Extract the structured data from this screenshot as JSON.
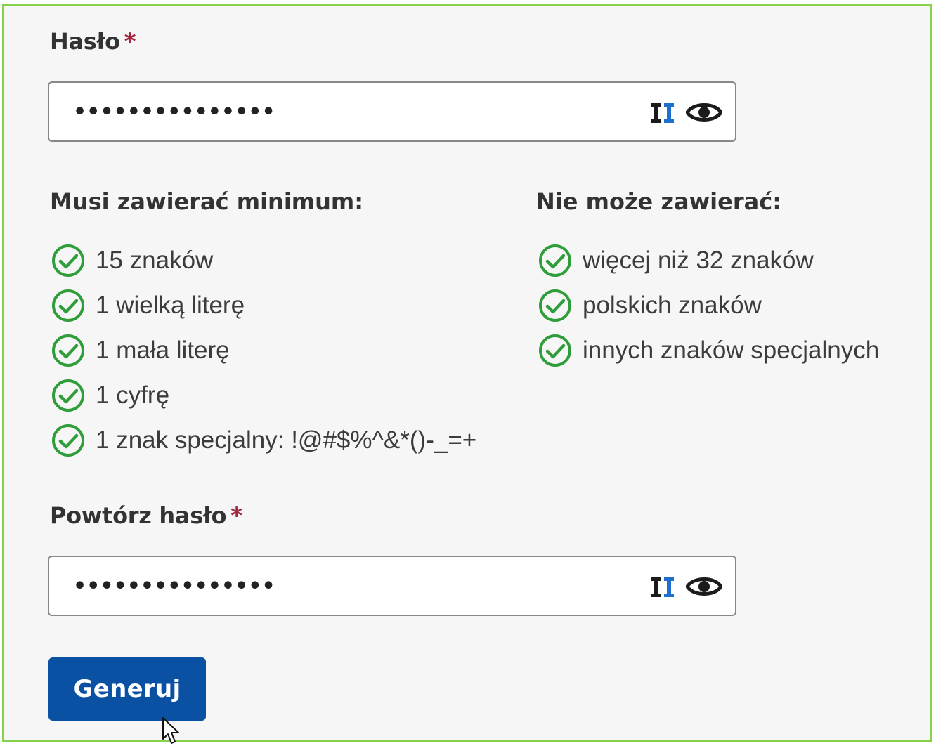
{
  "password_field": {
    "label": "Hasło",
    "required_mark": "*",
    "value": "•••••••••••••••",
    "generate_icon": "generator-icon",
    "toggle_icon": "eye-icon"
  },
  "rules": {
    "must_title": "Musi zawierać minimum:",
    "must_items": [
      "15 znaków",
      "1 wielką literę",
      "1 mała literę",
      "1 cyfrę",
      "1 znak specjalny: !@#$%^&*()-_=+"
    ],
    "cannot_title": "Nie może zawierać:",
    "cannot_items": [
      "więcej niż 32 znaków",
      "polskich znaków",
      "innych znaków specjalnych"
    ],
    "status_icon": "check-circle-icon"
  },
  "repeat_field": {
    "label": "Powtórz hasło",
    "required_mark": "*",
    "value": "•••••••••••••••",
    "generate_icon": "generator-icon",
    "toggle_icon": "eye-icon"
  },
  "actions": {
    "generate_label": "Generuj"
  },
  "colors": {
    "frame_border": "#86d24a",
    "check_green": "#2e9d3a",
    "required_red": "#a3243d",
    "button_blue": "#0a51a3"
  }
}
